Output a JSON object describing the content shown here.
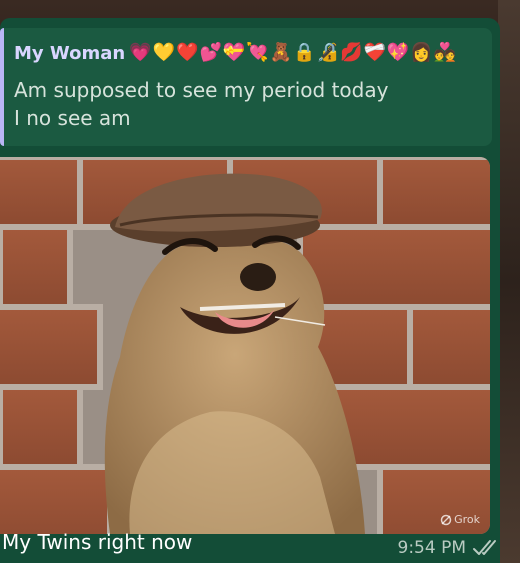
{
  "message": {
    "quoted": {
      "author": "My Woman",
      "emojis": [
        "💗",
        "💛",
        "❤️",
        "💕",
        "💝",
        "💘",
        "🧸",
        "🔒",
        "🔏",
        "💋",
        "❤️‍🩹",
        "💖",
        "👩",
        "💑"
      ],
      "lines": [
        "Am supposed to see my period today",
        "I no see am"
      ]
    },
    "image": {
      "description": "meerkat-wearing-flat-cap",
      "watermark": "Grok"
    },
    "caption": "My Twins right now",
    "time": "9:54 PM",
    "status": "read"
  },
  "colors": {
    "bubble": "#134d37",
    "quote_background": "#1b5a41",
    "quote_bar": "#b9b6f5",
    "author": "#d9d6ff",
    "read_ticks": "#b9cbc2"
  },
  "icons": {
    "status": "double-check-icon",
    "watermark": "grok-logo-icon"
  }
}
